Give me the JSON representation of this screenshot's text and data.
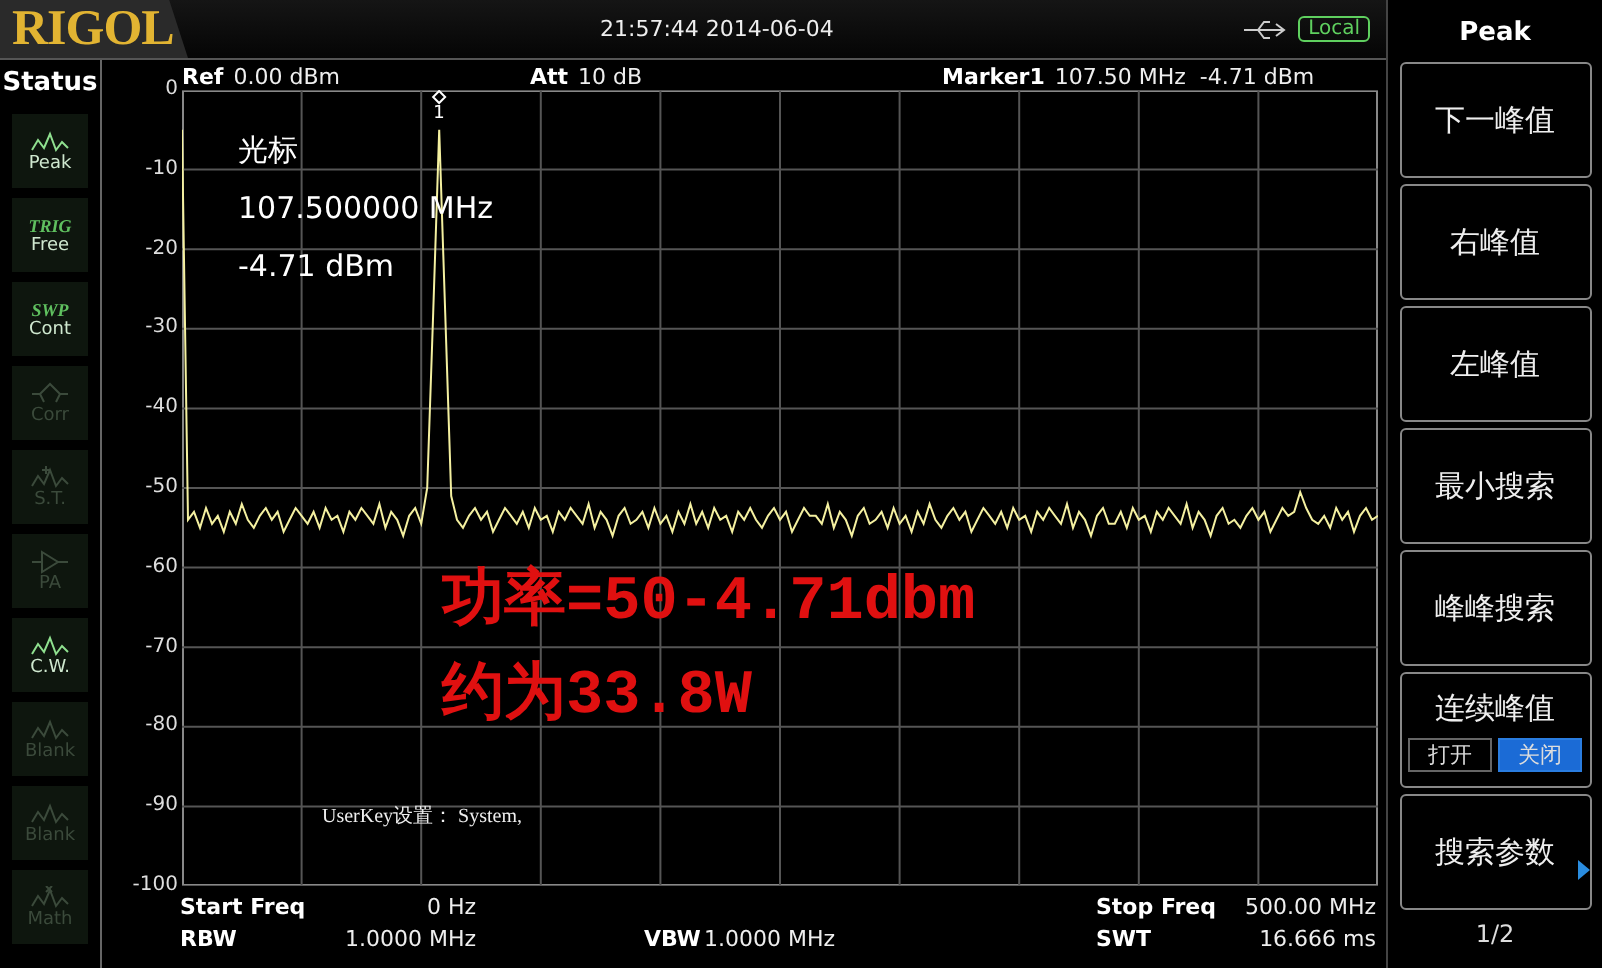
{
  "header": {
    "logo": "RIGOL",
    "datetime": "21:57:44 2014-06-04",
    "remote": "Local"
  },
  "status": {
    "title": "Status",
    "items": [
      {
        "kind": "peak",
        "label": "Peak",
        "enabled": true
      },
      {
        "kind": "trig",
        "tag": "TRIG",
        "label": "Free",
        "enabled": true
      },
      {
        "kind": "swp",
        "tag": "SWP",
        "label": "Cont",
        "enabled": true
      },
      {
        "kind": "corr",
        "label": "Corr",
        "enabled": false
      },
      {
        "kind": "st",
        "label": "S.T.",
        "enabled": false
      },
      {
        "kind": "pa",
        "label": "PA",
        "enabled": false
      },
      {
        "kind": "cw",
        "label": "C.W.",
        "enabled": true
      },
      {
        "kind": "wave",
        "label": "Blank",
        "enabled": false
      },
      {
        "kind": "wave",
        "label": "Blank",
        "enabled": false
      },
      {
        "kind": "math",
        "label": "Math",
        "enabled": false
      }
    ]
  },
  "plot": {
    "ref_label": "Ref",
    "ref_value": "0.00 dBm",
    "att_label": "Att",
    "att_value": "10 dB",
    "marker_label": "Marker1",
    "marker_freq": "107.50 MHz",
    "marker_level": "-4.71 dBm",
    "marker_number": "1",
    "marker_readout": [
      "光标",
      "107.500000 MHz",
      "-4.71 dBm"
    ],
    "user_key": "UserKey设置：  System,",
    "annotation": [
      "功率=50-4.71dbm",
      "约为33.8W"
    ],
    "chart_data": {
      "type": "line",
      "grid": true,
      "ylim": [
        -100,
        0
      ],
      "yticks": [
        {
          "value": 0,
          "label": "0"
        },
        {
          "value": -10,
          "label": "-10"
        },
        {
          "value": -20,
          "label": "-20"
        },
        {
          "value": -30,
          "label": "-30"
        },
        {
          "value": -40,
          "label": "-40"
        },
        {
          "value": -50,
          "label": "-50"
        },
        {
          "value": -60,
          "label": "-60"
        },
        {
          "value": -70,
          "label": "-70"
        },
        {
          "value": -80,
          "label": "-80"
        },
        {
          "value": -90,
          "label": "-90"
        },
        {
          "value": -100,
          "label": "-100"
        }
      ],
      "categories": [
        null,
        null,
        null,
        null,
        null,
        null,
        null,
        null,
        null,
        null,
        null,
        null,
        null,
        null,
        null,
        null,
        null,
        null,
        null,
        null,
        null,
        null,
        null,
        null,
        null,
        null,
        null,
        null,
        null,
        null,
        null,
        null,
        null,
        null,
        null,
        null,
        null,
        null,
        null,
        null,
        null,
        null,
        null,
        null,
        null,
        null,
        null,
        null,
        null,
        null,
        null,
        null,
        null,
        null,
        null,
        null,
        null,
        null,
        null,
        null,
        null,
        null,
        null,
        null,
        null,
        null,
        null,
        null,
        null,
        null,
        null,
        null,
        null,
        null,
        null,
        null,
        null,
        null,
        null,
        null,
        null,
        null,
        null,
        null,
        null,
        null,
        null,
        null,
        null,
        null,
        null,
        null,
        null,
        null,
        null,
        null,
        null,
        null,
        null,
        null,
        null,
        null,
        null,
        null,
        null,
        null,
        null,
        null,
        null,
        null,
        null,
        null,
        null,
        null,
        null,
        null,
        null,
        null,
        null,
        null,
        null,
        null,
        null,
        null,
        null,
        null,
        null,
        null,
        null,
        null,
        null,
        null,
        null,
        null,
        null,
        null,
        null,
        null,
        null,
        null,
        null,
        null,
        null,
        null,
        null,
        null,
        null,
        null,
        null,
        null,
        null,
        null,
        null,
        null,
        null,
        null,
        null,
        null,
        null,
        null,
        null,
        null,
        null,
        null,
        null,
        null,
        null,
        null,
        null,
        null,
        null,
        null,
        null,
        null,
        null,
        null,
        null,
        null,
        null,
        null,
        null,
        null,
        null,
        null,
        null,
        null,
        null,
        null,
        null,
        null,
        null,
        null,
        null,
        null,
        null,
        null,
        null,
        null,
        null,
        null,
        null
      ],
      "series": [
        {
          "color": "#f4f0a0",
          "values": [
            -5,
            -54,
            -53,
            -55,
            -52.5,
            -54.5,
            -53.5,
            -55.5,
            -53,
            -54.5,
            -52,
            -54,
            -55,
            -53.5,
            -52.5,
            -54,
            -53,
            -55.5,
            -54,
            -52.5,
            -53.5,
            -54.5,
            -53,
            -55,
            -52.5,
            -54,
            -53.5,
            -55.5,
            -53,
            -54,
            -52.5,
            -53.5,
            -54.5,
            -52,
            -55,
            -53,
            -54,
            -56,
            -53.5,
            -52.5,
            -54.5,
            -50,
            -28,
            -5,
            -28,
            -51,
            -54,
            -55,
            -53.5,
            -52.5,
            -54,
            -53,
            -55.5,
            -54,
            -52.5,
            -53.5,
            -54.5,
            -53,
            -55,
            -52.5,
            -54,
            -53.5,
            -55.5,
            -53,
            -54,
            -52.5,
            -53.5,
            -54.5,
            -52,
            -55,
            -53,
            -54,
            -56,
            -53.5,
            -52.5,
            -54.5,
            -54,
            -53,
            -55,
            -52.5,
            -54.5,
            -53.5,
            -55.5,
            -53,
            -54.5,
            -52,
            -54.5,
            -53,
            -55,
            -52.5,
            -54,
            -53.5,
            -55.5,
            -53,
            -54,
            -52.5,
            -54,
            -55,
            -53.5,
            -52.5,
            -54,
            -53,
            -55.5,
            -54,
            -52.5,
            -53.5,
            -53.5,
            -54.5,
            -52,
            -55,
            -53,
            -54,
            -56,
            -53.5,
            -52.5,
            -54.5,
            -54,
            -53,
            -55,
            -52.5,
            -54.5,
            -53.5,
            -55.5,
            -53,
            -54.5,
            -52,
            -54,
            -55,
            -53.5,
            -52.5,
            -54,
            -53,
            -55.5,
            -54,
            -52.5,
            -53.5,
            -54.5,
            -53,
            -55,
            -52.5,
            -54,
            -53.5,
            -55.5,
            -53,
            -54,
            -52.5,
            -53.5,
            -54.5,
            -52,
            -55,
            -53,
            -54,
            -56,
            -53.5,
            -52.5,
            -54.5,
            -54.5,
            -53,
            -55,
            -52.5,
            -54,
            -53.5,
            -55.5,
            -53,
            -54,
            -52.5,
            -53.5,
            -54.5,
            -52,
            -55,
            -53,
            -54,
            -56,
            -53.5,
            -52.5,
            -54.5,
            -54,
            -55,
            -53.5,
            -52.5,
            -54,
            -53,
            -55.5,
            -54,
            -52.5,
            -53.5,
            -53,
            -50.5,
            -52.5,
            -54,
            -54.5,
            -53.5,
            -55,
            -52.5,
            -54,
            -53,
            -55.5,
            -53.5,
            -52.5,
            -54,
            -53.5
          ]
        }
      ]
    }
  },
  "footer": {
    "rows": [
      {
        "left": {
          "label": "Start Freq",
          "value": "0 Hz"
        },
        "right": {
          "label": "Stop Freq",
          "value": "500.00 MHz"
        }
      },
      {
        "left": {
          "label": "RBW",
          "value": "1.0000 MHz"
        },
        "middle": {
          "label": "VBW",
          "value": "1.0000 MHz"
        },
        "right": {
          "label": "SWT",
          "value": "16.666 ms"
        }
      }
    ]
  },
  "softkeys": {
    "title": "Peak",
    "keys": [
      {
        "kind": "action",
        "label": "下一峰值"
      },
      {
        "kind": "action",
        "label": "右峰值"
      },
      {
        "kind": "action",
        "label": "左峰值"
      },
      {
        "kind": "action",
        "label": "最小搜索"
      },
      {
        "kind": "action",
        "label": "峰峰搜索"
      },
      {
        "kind": "toggle",
        "label": "连续峰值",
        "options": [
          {
            "label": "打开",
            "selected": false
          },
          {
            "label": "关闭",
            "selected": true
          }
        ]
      },
      {
        "kind": "submenu",
        "label": "搜索参数"
      }
    ],
    "page": "1/2"
  }
}
